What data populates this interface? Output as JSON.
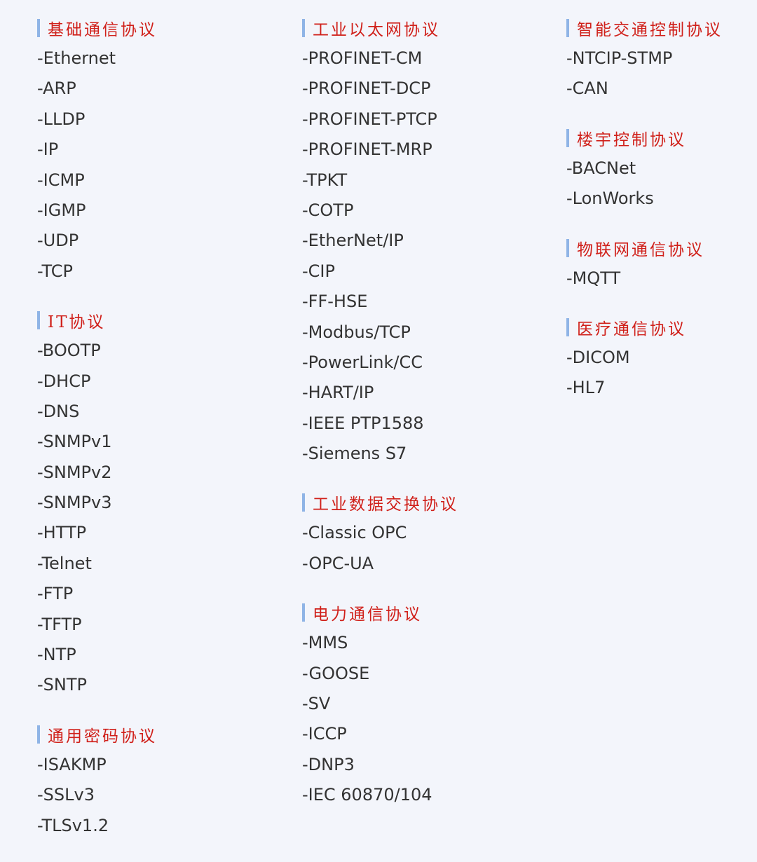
{
  "columns": [
    {
      "sections": [
        {
          "title": "基础通信协议",
          "items": [
            "-Ethernet",
            "-ARP",
            "-LLDP",
            "-IP",
            "-ICMP",
            "-IGMP",
            "-UDP",
            "-TCP"
          ]
        },
        {
          "title": "IT协议",
          "items": [
            "-BOOTP",
            "-DHCP",
            "-DNS",
            "-SNMPv1",
            "-SNMPv2",
            "-SNMPv3",
            "-HTTP",
            "-Telnet",
            "-FTP",
            "-TFTP",
            "-NTP",
            "-SNTP"
          ]
        },
        {
          "title": "通用密码协议",
          "items": [
            "-ISAKMP",
            "-SSLv3",
            "-TLSv1.2"
          ]
        }
      ]
    },
    {
      "sections": [
        {
          "title": "工业以太网协议",
          "items": [
            "-PROFINET-CM",
            "-PROFINET-DCP",
            "-PROFINET-PTCP",
            "-PROFINET-MRP",
            "-TPKT",
            "-COTP",
            "-EtherNet/IP",
            "-CIP",
            "-FF-HSE",
            "-Modbus/TCP",
            "-PowerLink/CC",
            "-HART/IP",
            "-IEEE PTP1588",
            "-Siemens S7"
          ]
        },
        {
          "title": "工业数据交换协议",
          "items": [
            "-Classic OPC",
            "-OPC-UA"
          ]
        },
        {
          "title": "电力通信协议",
          "items": [
            "-MMS",
            "-GOOSE",
            "-SV",
            "-ICCP",
            "-DNP3",
            "-IEC 60870/104"
          ]
        }
      ]
    },
    {
      "sections": [
        {
          "title": "智能交通控制协议",
          "items": [
            "-NTCIP-STMP",
            "-CAN"
          ]
        },
        {
          "title": "楼宇控制协议",
          "items": [
            "-BACNet",
            "-LonWorks"
          ]
        },
        {
          "title": "物联网通信协议",
          "items": [
            "-MQTT"
          ]
        },
        {
          "title": "医疗通信协议",
          "items": [
            "-DICOM",
            "-HL7"
          ]
        }
      ]
    }
  ],
  "colors": {
    "background": "#f3f5fb",
    "heading_text": "#d0201a",
    "heading_bar": "#8fb4e6",
    "item_text": "#333333"
  }
}
